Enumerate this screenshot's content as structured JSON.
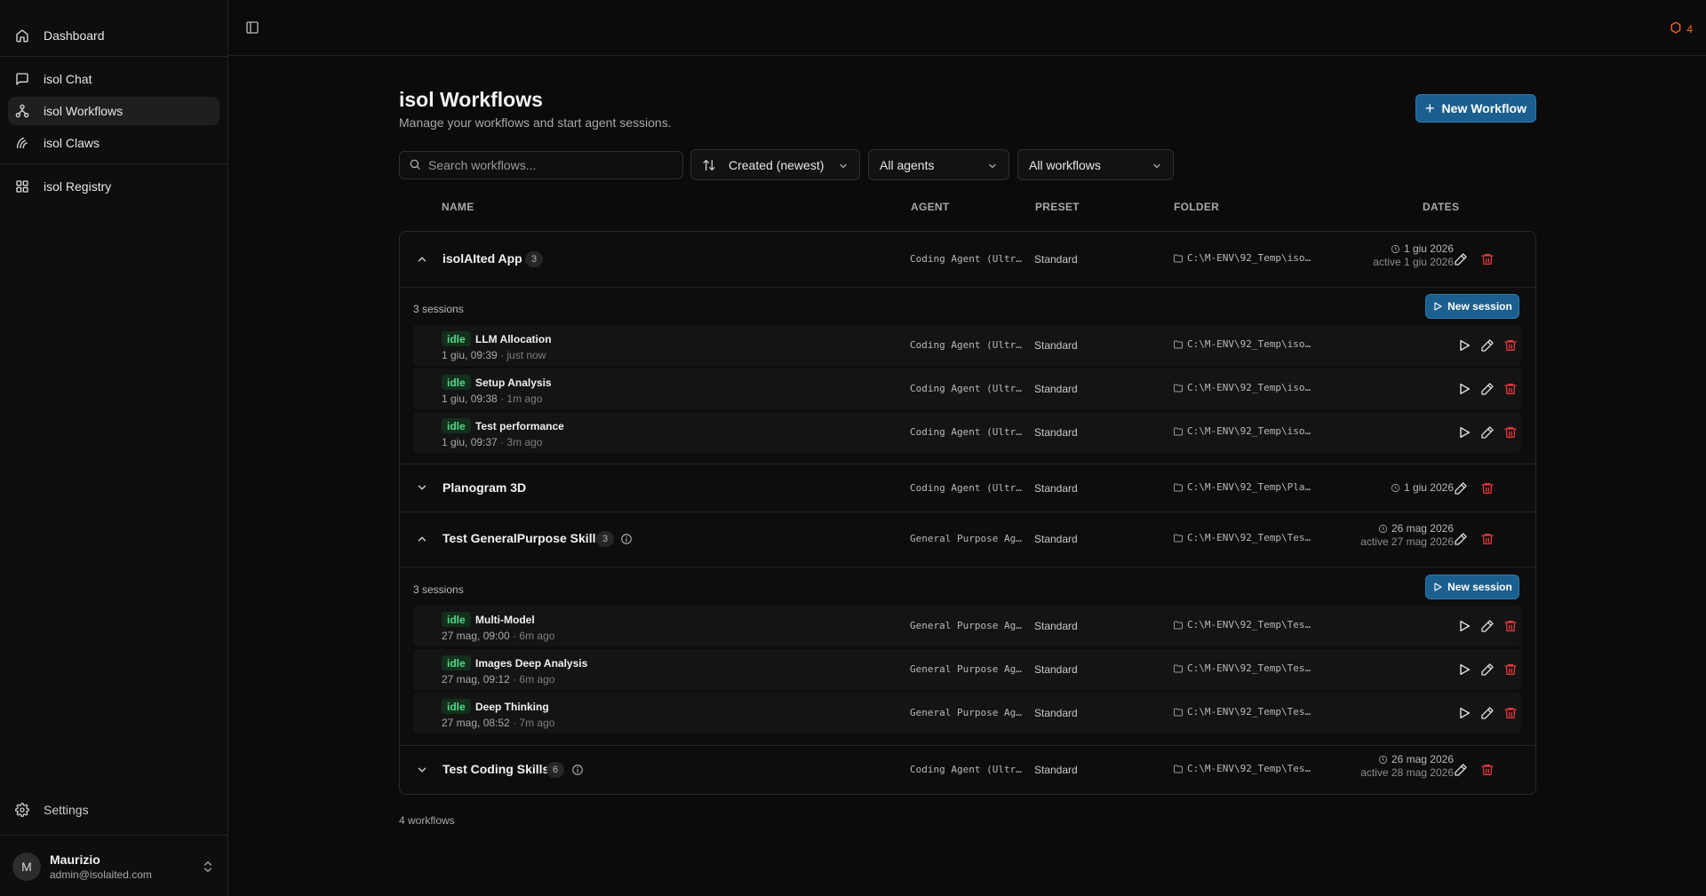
{
  "sidebar": {
    "items": [
      {
        "label": "Dashboard",
        "icon": "home-icon"
      },
      {
        "label": "isol Chat",
        "icon": "message-square-icon"
      },
      {
        "label": "isol Workflows",
        "icon": "workflow-icon",
        "active": true
      },
      {
        "label": "isol Claws",
        "icon": "claws-icon"
      },
      {
        "label": "isol Registry",
        "icon": "grid-icon"
      }
    ],
    "settings_label": "Settings",
    "user": {
      "initial": "M",
      "name": "Maurizio",
      "email": "admin@isolaited.com"
    }
  },
  "topbar": {
    "alert_count": "4",
    "alert_color": "#ff6a1a"
  },
  "header": {
    "title": "isol Workflows",
    "subtitle": "Manage your workflows and start agent sessions.",
    "new_workflow_label": "New Workflow"
  },
  "filters": {
    "search_placeholder": "Search workflows...",
    "sort_value": "Created (newest)",
    "agents_value": "All agents",
    "workflows_value": "All workflows"
  },
  "columns": {
    "name": "NAME",
    "agent": "AGENT",
    "preset": "PRESET",
    "folder": "FOLDER",
    "dates": "DATES"
  },
  "workflows": [
    {
      "name": "isolAIted App",
      "count": "3",
      "agent": "Coding Agent (Ultr…",
      "preset": "Standard",
      "folder": "C:\\M-ENV\\92_Temp\\iso…",
      "date": "1 giu 2026",
      "active": "active 1 giu 2026",
      "sessions_label": "3 sessions",
      "new_session_label": "New session",
      "sessions": [
        {
          "status": "idle",
          "title": "LLM Allocation",
          "time": "1 giu, 09:39",
          "ago": "· just now",
          "agent": "Coding Agent (Ultr…",
          "preset": "Standard",
          "folder": "C:\\M-ENV\\92_Temp\\iso…"
        },
        {
          "status": "idle",
          "title": "Setup Analysis",
          "time": "1 giu, 09:38",
          "ago": "· 1m ago",
          "agent": "Coding Agent (Ultr…",
          "preset": "Standard",
          "folder": "C:\\M-ENV\\92_Temp\\iso…"
        },
        {
          "status": "idle",
          "title": "Test performance",
          "time": "1 giu, 09:37",
          "ago": "· 3m ago",
          "agent": "Coding Agent (Ultr…",
          "preset": "Standard",
          "folder": "C:\\M-ENV\\92_Temp\\iso…"
        }
      ]
    },
    {
      "name": "Planogram 3D",
      "agent": "Coding Agent (Ultr…",
      "preset": "Standard",
      "folder": "C:\\M-ENV\\92_Temp\\Pla…",
      "date": "1 giu 2026"
    },
    {
      "name": "Test GeneralPurpose Skills",
      "count": "3",
      "agent": "General Purpose Ag…",
      "preset": "Standard",
      "folder": "C:\\M-ENV\\92_Temp\\Tes…",
      "date": "26 mag 2026",
      "active": "active 27 mag 2026",
      "sessions_label": "3 sessions",
      "new_session_label": "New session",
      "sessions": [
        {
          "status": "idle",
          "title": "Multi-Model",
          "time": "27 mag, 09:00",
          "ago": "· 6m ago",
          "agent": "General Purpose Ag…",
          "preset": "Standard",
          "folder": "C:\\M-ENV\\92_Temp\\Tes…"
        },
        {
          "status": "idle",
          "title": "Images Deep Analysis",
          "time": "27 mag, 09:12",
          "ago": "· 6m ago",
          "agent": "General Purpose Ag…",
          "preset": "Standard",
          "folder": "C:\\M-ENV\\92_Temp\\Tes…"
        },
        {
          "status": "idle",
          "title": "Deep Thinking",
          "time": "27 mag, 08:52",
          "ago": "· 7m ago",
          "agent": "General Purpose Ag…",
          "preset": "Standard",
          "folder": "C:\\M-ENV\\92_Temp\\Tes…"
        }
      ]
    },
    {
      "name": "Test Coding Skills",
      "count": "6",
      "agent": "Coding Agent (Ultr…",
      "preset": "Standard",
      "folder": "C:\\M-ENV\\92_Temp\\Tes…",
      "date": "26 mag 2026",
      "active": "active 28 mag 2026"
    }
  ],
  "footer": {
    "count_label": "4 workflows"
  },
  "colors": {
    "accent": "#1a5f8e",
    "idle_text": "#55d88a",
    "idle_bg": "#13301d",
    "delete": "#e0393b"
  }
}
